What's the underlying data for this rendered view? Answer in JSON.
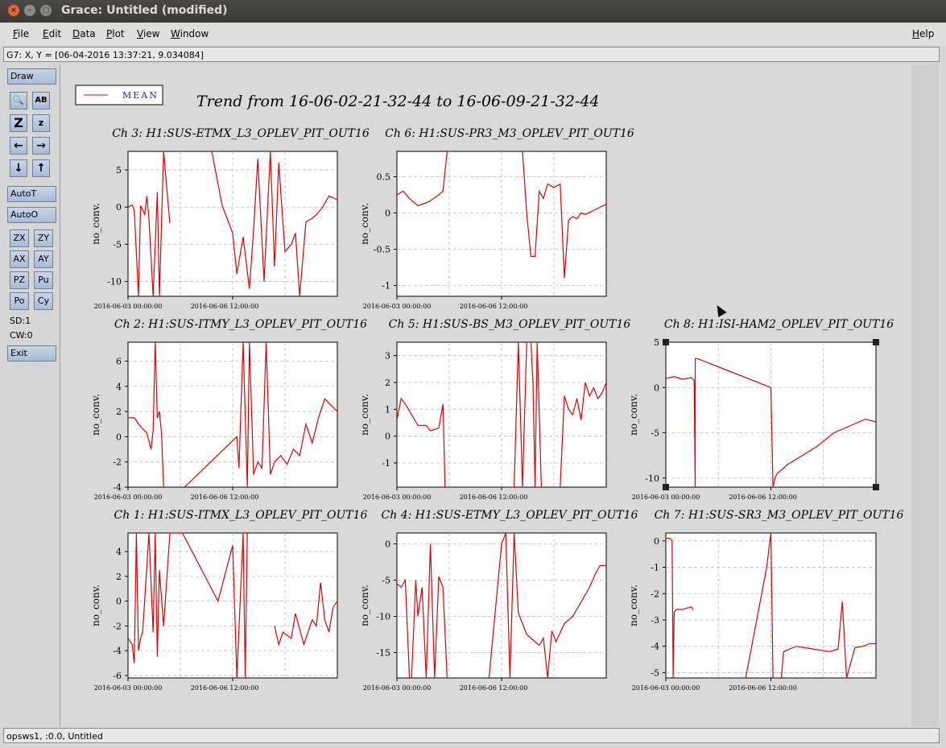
{
  "window": {
    "title": "Grace: Untitled (modified)",
    "close_glyph": "×",
    "minimize_glyph": "–",
    "maximize_glyph": "□"
  },
  "menubar": {
    "items": [
      "File",
      "Edit",
      "Data",
      "Plot",
      "View",
      "Window"
    ],
    "help": "Help"
  },
  "locator": {
    "text": "G7: X, Y = [06-04-2016 13:37:21, 9.034084]"
  },
  "tools": {
    "draw": "Draw",
    "zoom_glyph": "🔍",
    "text_glyph": "AB",
    "zoom_z_big": "Z",
    "zoom_z_small": "z",
    "arrow_left": "←",
    "arrow_right": "→",
    "arrow_down": "↓",
    "arrow_up": "↑",
    "autot": "AutoT",
    "autoo": "AutoO",
    "zx": "ZX",
    "zy": "ZY",
    "ax": "AX",
    "ay": "AY",
    "pz": "PZ",
    "pu": "Pu",
    "po": "Po",
    "cy": "Cy",
    "sd": "SD:1",
    "cw": "CW:0",
    "exit": "Exit"
  },
  "status": {
    "text": "opsws1, :0.0, Untitled"
  },
  "legend": {
    "label": "MEAN",
    "color": "#e00000"
  },
  "page_title": "Trend from 16-06-02-21-32-44 to 16-06-09-21-32-44",
  "colors": {
    "trace": "#e00000",
    "grid": "#bdbdbd",
    "plot_bg": "#ffffff"
  },
  "chart_data": [
    {
      "type": "line",
      "title": "Ch 3: H1:SUS-ETMX_L3_OPLEV_PIT_OUT16",
      "ylabel": "no_conv.",
      "xlabel": "",
      "x_ticks": [
        "2016-06-03 00:00:00",
        "2016-06-06 12:00:00"
      ],
      "y_ticks": [
        "5",
        "0",
        "-5",
        "-10"
      ],
      "ylim": [
        -12,
        7.5
      ],
      "series": [
        {
          "x": [
            0.0,
            0.02,
            0.03,
            0.05,
            0.06,
            0.08,
            0.09,
            0.1,
            0.12,
            0.14,
            0.15,
            0.17,
            0.2,
            0.22,
            0.4,
            0.45,
            0.5,
            0.52,
            0.55,
            0.58,
            0.6,
            0.62,
            0.65,
            0.68,
            0.7,
            0.72,
            0.75,
            0.78,
            0.8,
            0.82,
            0.85,
            0.88,
            0.9,
            0.93,
            0.96,
            1.0
          ],
          "y": [
            0.0,
            0.3,
            -0.5,
            -12,
            0.2,
            -1.0,
            1.5,
            -1.5,
            -12,
            2.0,
            -12,
            7.5,
            -2.2,
            null,
            7.5,
            0.2,
            -3.5,
            -9.0,
            -4.0,
            -11.0,
            -3.0,
            6.5,
            -10.0,
            7.5,
            -8.0,
            6.0,
            -6.0,
            -5.0,
            -3.5,
            -12,
            -2.0,
            -1.5,
            -1.0,
            0.0,
            1.5,
            1.0
          ]
        }
      ]
    },
    {
      "type": "line",
      "title": "Ch 6: H1:SUS-PR3_M3_OPLEV_PIT_OUT16",
      "ylabel": "no_conv.",
      "xlabel": "",
      "x_ticks": [
        "2016-06-03 00:00:00",
        "2016-06-06 12:00:00"
      ],
      "y_ticks": [
        "0.5",
        "0",
        "-0.5",
        "-1"
      ],
      "ylim": [
        -1.15,
        0.85
      ],
      "series": [
        {
          "x": [
            0.0,
            0.03,
            0.06,
            0.1,
            0.15,
            0.2,
            0.22,
            0.24,
            0.25,
            0.6,
            0.62,
            0.64,
            0.66,
            0.68,
            0.7,
            0.72,
            0.75,
            0.78,
            0.8,
            0.82,
            0.84,
            0.86,
            0.88,
            0.9,
            0.95,
            1.0
          ],
          "y": [
            0.25,
            0.3,
            0.2,
            0.1,
            0.15,
            0.25,
            0.3,
            0.85,
            null,
            0.85,
            0.0,
            -0.6,
            -0.6,
            0.3,
            0.2,
            0.4,
            0.35,
            0.4,
            -0.9,
            -0.1,
            -0.05,
            -0.08,
            0.0,
            -0.02,
            0.05,
            0.12
          ]
        }
      ]
    },
    {
      "type": "line",
      "title": "Ch 2: H1:SUS-ITMY_L3_OPLEV_PIT_OUT16",
      "ylabel": "no_conv.",
      "xlabel": "",
      "x_ticks": [
        "2016-06-03 00:00:00",
        "2016-06-06 12:00:00"
      ],
      "y_ticks": [
        "6",
        "4",
        "2",
        "0",
        "-2",
        "-4"
      ],
      "ylim": [
        -4,
        7.5
      ],
      "series": [
        {
          "x": [
            0.0,
            0.03,
            0.06,
            0.09,
            0.11,
            0.12,
            0.13,
            0.14,
            0.15,
            0.16,
            0.17,
            0.19,
            0.27,
            0.52,
            0.53,
            0.55,
            0.57,
            0.58,
            0.6,
            0.62,
            0.64,
            0.66,
            0.68,
            0.7,
            0.73,
            0.76,
            0.79,
            0.82,
            0.85,
            0.88,
            0.91,
            0.94,
            0.97,
            1.0
          ],
          "y": [
            1.5,
            1.5,
            0.8,
            0.3,
            -1.0,
            0.5,
            7.5,
            1.5,
            2.0,
            0.3,
            -4,
            null,
            -4,
            0.0,
            -2.5,
            7.5,
            -4,
            7.5,
            -3.0,
            -2.0,
            -2.5,
            7.5,
            -3.0,
            -2.0,
            -1.5,
            -2.2,
            -1.0,
            -1.5,
            1.0,
            -0.5,
            1.5,
            3.0,
            2.5,
            2.0
          ]
        }
      ]
    },
    {
      "type": "line",
      "title": "Ch 5: H1:SUS-BS_M3_OPLEV_PIT_OUT16",
      "ylabel": "no_conv.",
      "xlabel": "",
      "x_ticks": [
        "2016-06-03 00:00:00",
        "2016-06-06 12:00:00"
      ],
      "y_ticks": [
        "3",
        "2",
        "1",
        "0",
        "-1"
      ],
      "ylim": [
        -1.9,
        3.5
      ],
      "series": [
        {
          "x": [
            0.0,
            0.02,
            0.04,
            0.07,
            0.1,
            0.14,
            0.16,
            0.2,
            0.22,
            0.23,
            0.24,
            null,
            0.56,
            0.58,
            0.6,
            0.62,
            0.64,
            0.65,
            0.66,
            0.67,
            0.69,
            null,
            0.78,
            0.8,
            0.82,
            0.84,
            0.86,
            0.88,
            0.9,
            0.92,
            0.94,
            0.96,
            0.98,
            1.0
          ],
          "y": [
            0.6,
            1.4,
            1.2,
            0.8,
            0.4,
            0.4,
            0.2,
            0.3,
            1.2,
            -1.9,
            -1.9,
            null,
            -1.9,
            3.5,
            -1.9,
            3.5,
            3.5,
            2.0,
            -1.9,
            3.5,
            -1.9,
            null,
            -1.9,
            1.5,
            1.0,
            0.8,
            1.4,
            0.6,
            2.0,
            1.5,
            1.8,
            1.4,
            1.6,
            2.0
          ]
        }
      ]
    },
    {
      "type": "line",
      "title": "Ch 8: H1:ISI-HAM2_OPLEV_PIT_OUT16",
      "ylabel": "no_conv.",
      "xlabel": "",
      "x_ticks": [
        "2016-06-03 00:00:00",
        "2016-06-06 12:00:00"
      ],
      "y_ticks": [
        "5",
        "0",
        "-5",
        "-10"
      ],
      "ylim": [
        -11,
        5
      ],
      "series": [
        {
          "x": [
            0.0,
            0.04,
            0.08,
            0.12,
            0.135,
            0.14,
            0.14,
            0.15,
            0.5,
            0.51,
            0.51,
            0.52,
            0.53,
            0.58,
            0.65,
            0.72,
            0.8,
            0.88,
            0.95,
            1.0
          ],
          "y": [
            1.0,
            1.2,
            0.9,
            1.1,
            0.8,
            -11,
            3.2,
            3.2,
            0.0,
            -11,
            -11,
            -10.0,
            -9.5,
            -8.5,
            -7.5,
            -6.5,
            -5.0,
            -4.2,
            -3.5,
            -3.8
          ]
        }
      ]
    },
    {
      "type": "line",
      "title": "Ch 1: H1:SUS-ITMX_L3_OPLEV_PIT_OUT16",
      "ylabel": "no_conv.",
      "xlabel": "",
      "x_ticks": [
        "2016-06-03 00:00:00",
        "2016-06-06 12:00:00"
      ],
      "y_ticks": [
        "4",
        "2",
        "0",
        "-2",
        "-4",
        "-6"
      ],
      "ylim": [
        -6.2,
        5.5
      ],
      "series": [
        {
          "x": [
            0.0,
            0.02,
            0.03,
            0.04,
            0.05,
            0.06,
            0.07,
            0.1,
            0.12,
            0.13,
            0.14,
            0.15,
            0.17,
            0.2,
            0.26,
            0.43,
            0.5,
            0.52,
            0.55,
            0.56,
            0.57,
            0.6,
            0.7,
            0.72,
            0.74,
            0.78,
            0.8,
            0.84,
            0.88,
            0.9,
            0.92,
            0.94,
            0.96,
            0.98,
            1.0
          ],
          "y": [
            -3.0,
            -3.5,
            -5.0,
            5.5,
            -4.0,
            -3.0,
            -2.5,
            5.5,
            -2.5,
            5.5,
            -4.5,
            2.5,
            -2.0,
            5.5,
            5.5,
            0.0,
            4.5,
            -6.2,
            5.5,
            -6.2,
            5.5,
            null,
            -2.0,
            -3.5,
            -2.5,
            -3.0,
            -1.0,
            -3.5,
            -1.5,
            -2.0,
            1.5,
            -1.5,
            -2.5,
            -0.5,
            0.0
          ]
        }
      ]
    },
    {
      "type": "line",
      "title": "Ch 4: H1:SUS-ETMY_L3_OPLEV_PIT_OUT16",
      "ylabel": "no_conv.",
      "xlabel": "",
      "x_ticks": [
        "2016-06-03 00:00:00",
        "2016-06-06 12:00:00"
      ],
      "y_ticks": [
        "0",
        "-5",
        "-10",
        "-15"
      ],
      "ylim": [
        -18.5,
        1.5
      ],
      "series": [
        {
          "x": [
            0.0,
            0.02,
            0.04,
            0.06,
            0.07,
            0.09,
            0.1,
            0.12,
            0.14,
            0.16,
            0.18,
            0.2,
            0.22,
            0.24,
            null,
            0.44,
            0.5,
            0.52,
            0.54,
            0.56,
            0.58,
            0.6,
            0.62,
            0.64,
            0.66,
            0.68,
            0.7,
            0.72,
            0.74,
            0.76,
            0.8,
            0.84,
            0.88,
            0.92,
            0.95,
            0.97,
            1.0
          ],
          "y": [
            -5.5,
            -6.0,
            -5.0,
            -18.5,
            -18.5,
            -5.0,
            -10.0,
            -6.0,
            -18.5,
            0.0,
            -18.5,
            -4.5,
            -6.0,
            -18.5,
            null,
            -18.5,
            0.0,
            1.5,
            -18.5,
            1.5,
            -9.5,
            -11.0,
            -12.5,
            -13.0,
            -13.5,
            -14.0,
            -13.0,
            -18.5,
            -12.0,
            -13.5,
            -11.0,
            -10.0,
            -8.0,
            -6.0,
            -4.0,
            -3.0,
            -3.0
          ]
        }
      ]
    },
    {
      "type": "line",
      "title": "Ch 7: H1:SUS-SR3_M3_OPLEV_PIT_OUT16",
      "ylabel": "no_conv.",
      "xlabel": "",
      "x_ticks": [
        "2016-06-03 00:00:00",
        "2016-06-06 12:00:00"
      ],
      "y_ticks": [
        "0",
        "-1",
        "-2",
        "-3",
        "-4",
        "-5"
      ],
      "ylim": [
        -5.2,
        0.3
      ],
      "series": [
        {
          "x": [
            0.0,
            0.02,
            0.03,
            0.035,
            0.04,
            0.05,
            0.08,
            0.12,
            0.13,
            null,
            0.38,
            0.48,
            0.5,
            0.51,
            null,
            0.55,
            0.56,
            0.62,
            0.7,
            0.78,
            0.82,
            0.84,
            0.86,
            0.9,
            0.94,
            0.97,
            1.0
          ],
          "y": [
            0.1,
            0.1,
            0.0,
            -5.2,
            -2.7,
            -2.6,
            -2.6,
            -2.5,
            -2.6,
            null,
            -5.2,
            -1.0,
            0.3,
            -5.2,
            null,
            -5.2,
            -4.2,
            -4.0,
            -4.1,
            -4.2,
            -4.1,
            -2.3,
            -5.2,
            -4.05,
            -4.0,
            -3.9,
            -3.9
          ]
        }
      ]
    }
  ]
}
